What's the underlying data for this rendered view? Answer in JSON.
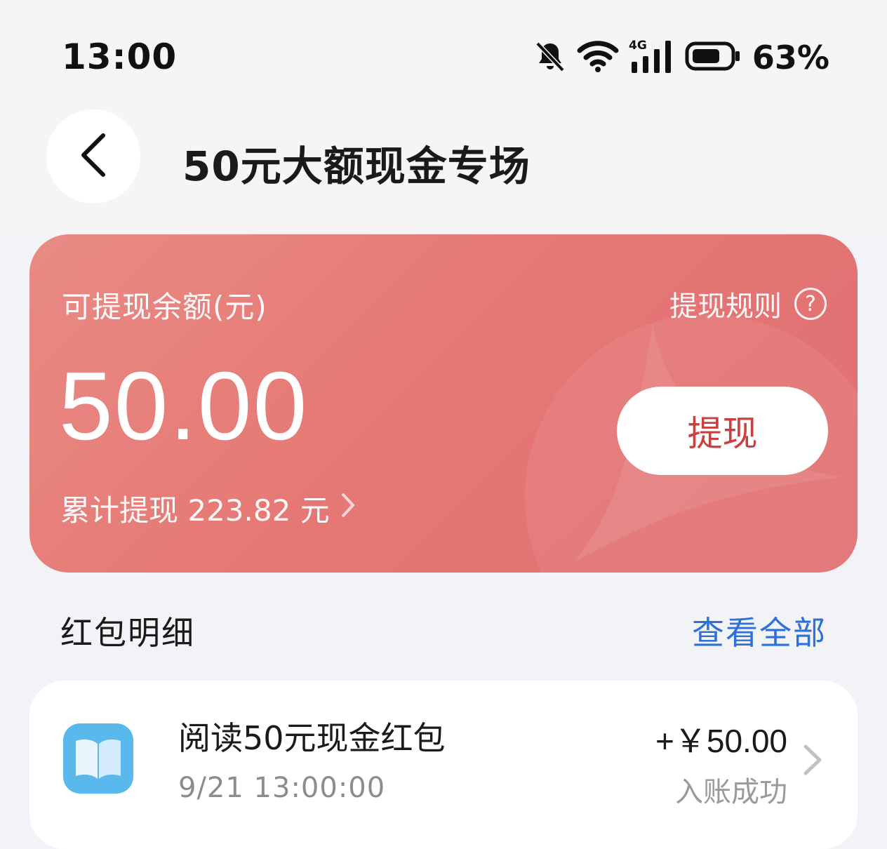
{
  "status_bar": {
    "time": "13:00",
    "network": "4G",
    "battery_percent": "63%",
    "icons": [
      "bell-muted-icon",
      "wifi-icon",
      "cellular-signal-icon",
      "battery-icon"
    ]
  },
  "header": {
    "title": "50元大额现金专场",
    "back_icon": "chevron-left-icon"
  },
  "balance_card": {
    "label": "可提现余额(元)",
    "rules_label": "提现规则",
    "rules_icon": "?",
    "amount": "50.00",
    "withdraw_label": "提现",
    "total_label": "累计提现 223.82 元",
    "colors": {
      "card": "#e57774",
      "button_text": "#c9403d"
    }
  },
  "red_packet_section": {
    "title": "红包明细",
    "view_all_label": "查看全部",
    "view_all_color": "#2f6fd8",
    "records": [
      {
        "icon": "book-icon",
        "title": "阅读50元现金红包",
        "time": "9/21 13:00:00",
        "amount": "+￥50.00",
        "status": "入账成功"
      }
    ]
  }
}
